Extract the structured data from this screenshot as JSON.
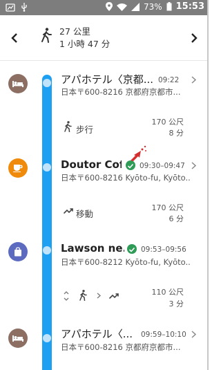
{
  "status_bar": {
    "battery": "73%",
    "time": "15:53"
  },
  "header": {
    "distance": "27 公里",
    "duration": "1 小時 47 分"
  },
  "places": [
    {
      "name": "アパホテル〈京都...",
      "time": "09:22",
      "address": "日本〒600-8216 京都府京都市..."
    },
    {
      "name": "Doutor Cof...",
      "time": "09:30–09:47",
      "address": "日本〒600-8216 Kyōto-fu, Kyōto..."
    },
    {
      "name": "Lawson ne...",
      "time": "09:53–09:56",
      "address": "日本〒600-8212 Kyōto-fu, Kyōto..."
    },
    {
      "name": "アパホテル〈...",
      "time": "09:59–10:10",
      "address": "日本〒600-8216 京都府京都市..."
    }
  ],
  "segments": [
    {
      "label": "步行",
      "distance": "170 公尺",
      "duration": "8 分"
    },
    {
      "label": "移動",
      "distance": "170 公尺",
      "duration": "6 分"
    },
    {
      "label": "",
      "distance": "110 公尺",
      "duration": "3 分"
    }
  ],
  "colors": {
    "timeline": "#1ea0f2",
    "hotel": "#8d6e63",
    "cafe": "#ef8a0b",
    "shop": "#5c6bc0",
    "check": "#2e9c57"
  }
}
